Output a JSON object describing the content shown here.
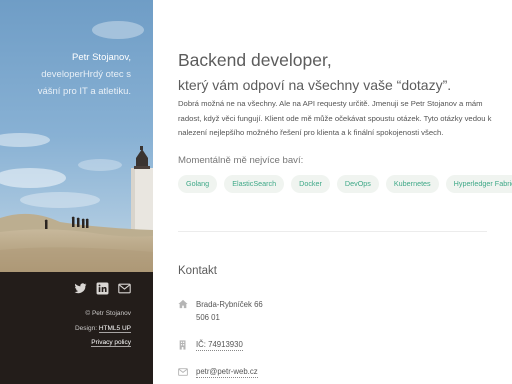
{
  "sidebar": {
    "name": "Petr Stojanov,",
    "intro_line2": "developerHrdý otec s",
    "intro_line3": "vášní pro IT a atletiku.",
    "socials": [
      "twitter-icon",
      "linkedin-icon",
      "envelope-icon"
    ],
    "copyright": "© Petr Stojanov",
    "design_label": "Design: ",
    "design_link": "HTML5 UP",
    "privacy_link": "Privacy policy"
  },
  "main": {
    "headline": "Backend developer,",
    "subheadline": "který vám odpoví na všechny vaše “dotazy”.",
    "about": "Dobrá možná ne na všechny. Ale na API requesty určitě. Jmenuji se Petr Stojanov a mám radost, když věci fungují. Klient ode mě může očekávat spoustu otázek. Tyto otázky vedou k nalezení nejlepšího možného řešení pro klienta a k finální spokojenosti všech.",
    "interests_title": "Momentálně mě nejvíce baví:",
    "tags": [
      "Golang",
      "ElasticSearch",
      "Docker",
      "DevOps",
      "Kubernetes",
      "Hyperledger Fabric"
    ],
    "contact_title": "Kontakt",
    "address_line1": "Brada-Rybníček 66",
    "address_line2": "506 01",
    "ico": "IČ: 74913930",
    "email": "petr@petr-web.cz"
  },
  "colors": {
    "accent": "#3ea887",
    "tag_bg": "#f0f4f0",
    "footer_bg": "#231d1a"
  }
}
